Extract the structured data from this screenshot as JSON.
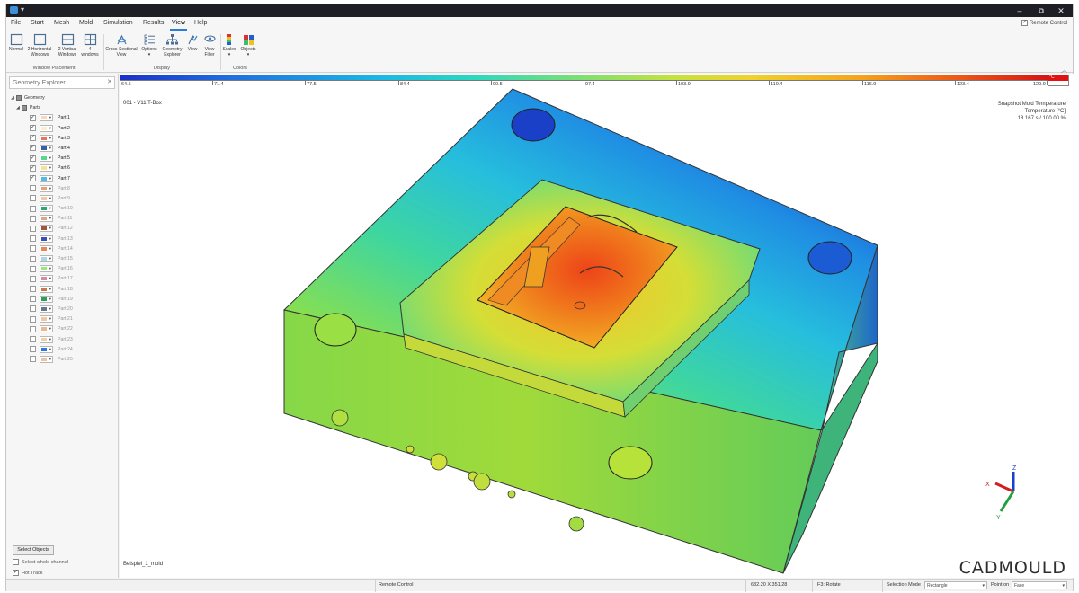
{
  "titlebar": {
    "minimize": "–",
    "restore": "⧉",
    "close": "✕"
  },
  "menu": {
    "items": [
      "File",
      "Start",
      "Mesh",
      "Mold",
      "Simulation",
      "Results",
      "View",
      "Help"
    ],
    "active": "View",
    "remote_control_label": "Remote Control",
    "remote_control_checked": true
  },
  "ribbon": {
    "groups": [
      {
        "label": "Window Placement",
        "buttons": [
          {
            "id": "normal",
            "label": "Normal",
            "icon": "window-normal-icon"
          },
          {
            "id": "2h",
            "label": "2 Horizontal Windows",
            "icon": "window-horizontal-icon"
          },
          {
            "id": "2v",
            "label": "2 Vertical Windows",
            "icon": "window-vertical-icon"
          },
          {
            "id": "4w",
            "label": "4 windows",
            "icon": "window-quad-icon"
          }
        ]
      },
      {
        "label": "Display",
        "buttons": [
          {
            "id": "xsec",
            "label": "Cross-Sectional View",
            "icon": "cross-section-icon"
          },
          {
            "id": "opts",
            "label": "Options",
            "icon": "options-list-icon"
          },
          {
            "id": "geo",
            "label": "Geometry Explorer",
            "icon": "geometry-tree-icon"
          },
          {
            "id": "view",
            "label": "View",
            "icon": "view-camera-icon"
          },
          {
            "id": "filter",
            "label": "View Filter",
            "icon": "eye-filter-icon"
          }
        ]
      },
      {
        "label": "Colors",
        "buttons": [
          {
            "id": "scales",
            "label": "Scales",
            "icon": "scales-icon"
          },
          {
            "id": "objects",
            "label": "Objects",
            "icon": "objects-color-icon"
          }
        ]
      }
    ]
  },
  "explorer": {
    "search_placeholder": "Geometry Explorer",
    "root_label": "Geometry",
    "parts_label": "Parts",
    "parts": [
      {
        "label": "Part 1",
        "checked": true,
        "color": "#f5d9b8"
      },
      {
        "label": "Part 2",
        "checked": true,
        "color": "#f5f1d0"
      },
      {
        "label": "Part 3",
        "checked": true,
        "color": "#e8735a"
      },
      {
        "label": "Part 4",
        "checked": true,
        "color": "#3a5fa8"
      },
      {
        "label": "Part 5",
        "checked": true,
        "color": "#58d88a"
      },
      {
        "label": "Part 6",
        "checked": true,
        "color": "#f3e39a"
      },
      {
        "label": "Part 7",
        "checked": true,
        "color": "#52b8e8"
      },
      {
        "label": "Part 8",
        "checked": false,
        "color": "#e8a070"
      },
      {
        "label": "Part 9",
        "checked": false,
        "color": "#f0c8a8"
      },
      {
        "label": "Part 10",
        "checked": false,
        "color": "#2aa878"
      },
      {
        "label": "Part 11",
        "checked": false,
        "color": "#d8a880"
      },
      {
        "label": "Part 12",
        "checked": false,
        "color": "#a05838"
      },
      {
        "label": "Part 13",
        "checked": false,
        "color": "#3a4fb8"
      },
      {
        "label": "Part 14",
        "checked": false,
        "color": "#e8885a"
      },
      {
        "label": "Part 15",
        "checked": false,
        "color": "#a8d8e8"
      },
      {
        "label": "Part 16",
        "checked": false,
        "color": "#98e878"
      },
      {
        "label": "Part 17",
        "checked": false,
        "color": "#d888a8"
      },
      {
        "label": "Part 18",
        "checked": false,
        "color": "#c87848"
      },
      {
        "label": "Part 19",
        "checked": false,
        "color": "#28a058"
      },
      {
        "label": "Part 20",
        "checked": false,
        "color": "#687888"
      },
      {
        "label": "Part 21",
        "checked": false,
        "color": "#f0c8a0"
      },
      {
        "label": "Part 22",
        "checked": false,
        "color": "#e8b898"
      },
      {
        "label": "Part 23",
        "checked": false,
        "color": "#f0d0a0"
      },
      {
        "label": "Part 24",
        "checked": false,
        "color": "#2a78e0"
      },
      {
        "label": "Part 25",
        "checked": false,
        "color": "#f0c0a0"
      }
    ],
    "select_objects_label": "Select Objects",
    "select_whole_channel_label": "Select whole channel",
    "select_whole_channel_checked": false,
    "hot_track_label": "Hot Track",
    "hot_track_checked": true
  },
  "viewport": {
    "scale": {
      "ticks": [
        "64.5",
        "71.4",
        "77.5",
        "84.4",
        "90.5",
        "97.4",
        "103.9",
        "110.4",
        "116.9",
        "123.4",
        "129.9"
      ],
      "unit": "°C"
    },
    "model_title": "001 - V11 T-Box",
    "result_title": "Snapshot Mold Temperature",
    "result_quantity": "Temperature [°C]",
    "result_time": "18.167 s  /  100.00 %",
    "model_file": "Beispiel_1_mold",
    "brand": "CADMOULD",
    "axes": {
      "x": "X",
      "y": "Y",
      "z": "Z"
    }
  },
  "status": {
    "remote_control": "Remote Control",
    "coords": "682.20 X 351.28",
    "hint": "F3: Rotate",
    "selection_mode_label": "Selection Mode",
    "selection_mode_value": "Rectangle",
    "point_on_label": "Point on",
    "point_on_value": "Face"
  }
}
